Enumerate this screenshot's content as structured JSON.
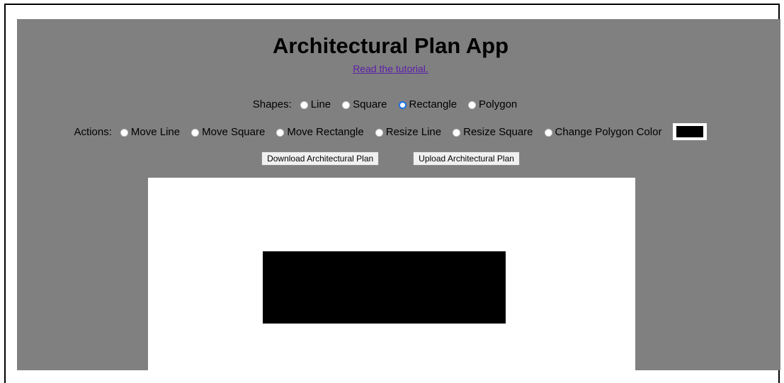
{
  "header": {
    "title": "Architectural Plan App",
    "tutorial_link": "Read the tutorial."
  },
  "shapes": {
    "label": "Shapes:",
    "options": [
      {
        "label": "Line",
        "checked": false
      },
      {
        "label": "Square",
        "checked": false
      },
      {
        "label": "Rectangle",
        "checked": true
      },
      {
        "label": "Polygon",
        "checked": false
      }
    ]
  },
  "actions": {
    "label": "Actions:",
    "options": [
      {
        "label": "Move Line",
        "checked": false
      },
      {
        "label": "Move Square",
        "checked": false
      },
      {
        "label": "Move Rectangle",
        "checked": false
      },
      {
        "label": "Resize Line",
        "checked": false
      },
      {
        "label": "Resize Square",
        "checked": false
      },
      {
        "label": "Change Polygon Color",
        "checked": false
      }
    ],
    "polygon_color": "#000000"
  },
  "buttons": {
    "download_label": "Download Architectural Plan",
    "upload_label": "Upload Architectural Plan"
  },
  "canvas": {
    "background": "#ffffff",
    "shape_color": "#000000"
  },
  "colors": {
    "app_background": "#808080",
    "link": "#5b1ea8",
    "radio_checked": "#1a6fe8"
  }
}
